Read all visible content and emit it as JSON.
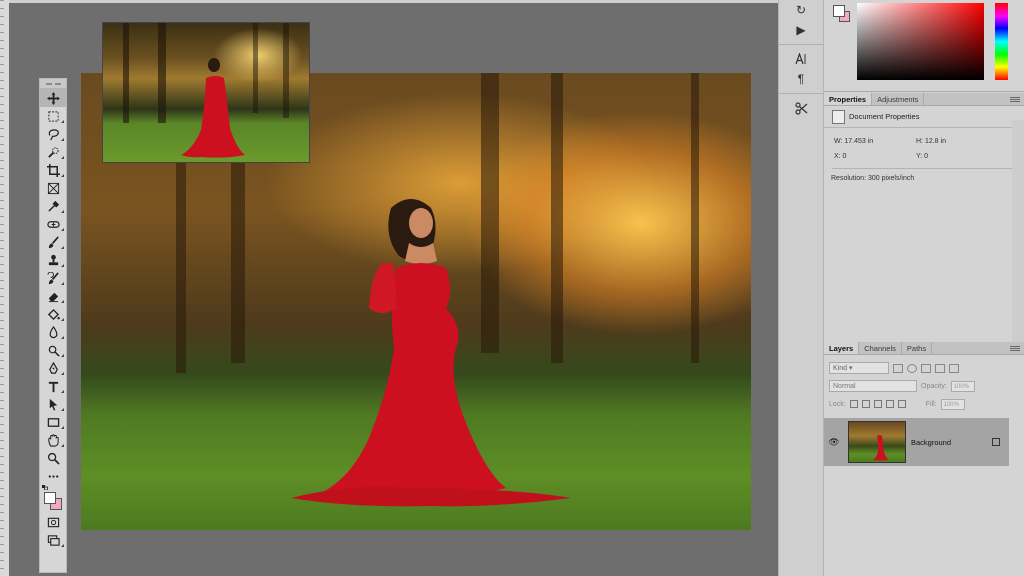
{
  "colors": {
    "foreground": "#ffffff",
    "background": "#f4a9c2",
    "panel": "#d4d4d4",
    "workspace": "#6e6e6e"
  },
  "toolbar": {
    "tools": [
      {
        "name": "move-tool-icon",
        "active": true
      },
      {
        "name": "marquee-tool-icon"
      },
      {
        "name": "lasso-tool-icon"
      },
      {
        "name": "quick-selection-tool-icon"
      },
      {
        "name": "crop-tool-icon"
      },
      {
        "name": "frame-tool-icon"
      },
      {
        "name": "eyedropper-tool-icon"
      },
      {
        "name": "healing-brush-tool-icon"
      },
      {
        "name": "brush-tool-icon"
      },
      {
        "name": "clone-stamp-tool-icon"
      },
      {
        "name": "history-brush-tool-icon"
      },
      {
        "name": "eraser-tool-icon"
      },
      {
        "name": "paint-bucket-tool-icon"
      },
      {
        "name": "blur-tool-icon"
      },
      {
        "name": "dodge-tool-icon"
      },
      {
        "name": "pen-tool-icon"
      },
      {
        "name": "type-tool-icon"
      },
      {
        "name": "path-selection-tool-icon"
      },
      {
        "name": "rectangle-tool-icon"
      },
      {
        "name": "hand-tool-icon"
      },
      {
        "name": "zoom-tool-icon"
      },
      {
        "name": "more-tools-icon"
      }
    ]
  },
  "properties": {
    "tabs": [
      "Properties",
      "Adjustments"
    ],
    "doc_label": "Document Properties",
    "width": "W: 17.453 in",
    "height": "H: 12.8 in",
    "x": "X: 0",
    "y": "Y: 0",
    "resolution": "Resolution: 300 pixels/inch"
  },
  "layers": {
    "tabs": [
      "Layers",
      "Channels",
      "Paths"
    ],
    "kind": "Kind",
    "blend_mode": "Normal",
    "opacity_label": "Opacity:",
    "opacity_value": "100%",
    "lock_label": "Lock:",
    "fill_label": "Fill:",
    "fill_value": "100%",
    "items": [
      {
        "name": "Background",
        "visible": true,
        "locked": true
      }
    ]
  }
}
